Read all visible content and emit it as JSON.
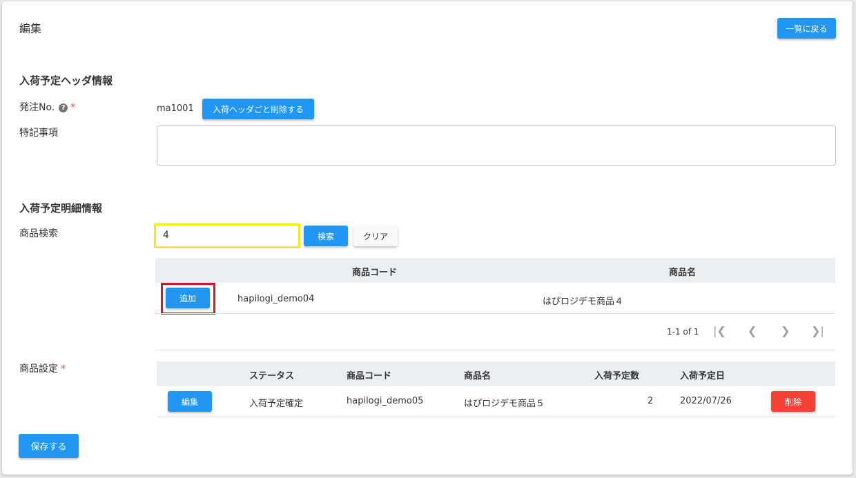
{
  "page": {
    "title": "編集",
    "back_button": "一覧に戻る"
  },
  "header_section": {
    "title": "入荷予定ヘッダ情報",
    "order_no_label": "発注No.",
    "order_no_value": "ma1001",
    "delete_header_button": "入荷ヘッダごと削除する",
    "notes_label": "特記事項",
    "notes_value": ""
  },
  "detail_section": {
    "title": "入荷予定明細情報",
    "product_search_label": "商品検索",
    "search_value": "4",
    "search_button": "検索",
    "clear_button": "クリア",
    "search_table": {
      "columns": [
        "商品コード",
        "商品名"
      ],
      "rows": [
        {
          "action": "追加",
          "code": "hapilogi_demo04",
          "name": "はぴロジデモ商品４"
        }
      ],
      "pagination": "1-1 of 1"
    },
    "product_setting_label": "商品設定",
    "setting_table": {
      "columns": [
        "ステータス",
        "商品コード",
        "商品名",
        "入荷予定数",
        "入荷予定日"
      ],
      "rows": [
        {
          "edit": "編集",
          "status": "入荷予定確定",
          "code": "hapilogi_demo05",
          "name": "はぴロジデモ商品５",
          "qty": "2",
          "date": "2022/07/26",
          "delete": "削除"
        }
      ]
    }
  },
  "save_button": "保存する",
  "colors": {
    "primary": "#2196f3",
    "danger": "#f44336",
    "highlight_yellow": "#f5ea0f",
    "highlight_red": "#e5141c"
  }
}
